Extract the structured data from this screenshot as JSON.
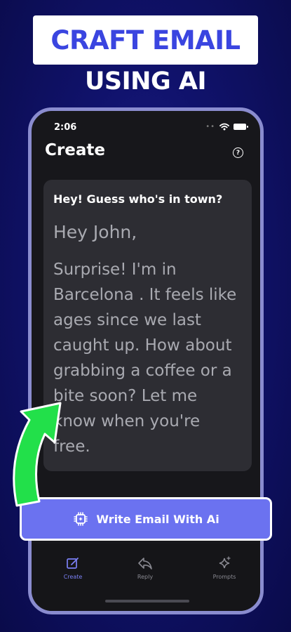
{
  "promo": {
    "headline": "CRAFT EMAIL",
    "subheadline": "USING AI"
  },
  "status_bar": {
    "time": "2:06"
  },
  "screen": {
    "title": "Create",
    "help_symbol": "?"
  },
  "email": {
    "subject": "Hey! Guess who's in town?",
    "greeting": "Hey John,",
    "body": "Surprise! I'm in Barcelona . It feels like ages since we last caught up. How about grabbing a coffee or a bite soon? Let me know when you're free."
  },
  "cta": {
    "label": "Write Email With Ai",
    "icon": "ai-chip-icon"
  },
  "tabbar": {
    "items": [
      {
        "label": "Create",
        "icon": "compose-icon",
        "active": true
      },
      {
        "label": "Reply",
        "icon": "reply-arrow-icon",
        "active": false
      },
      {
        "label": "Prompts",
        "icon": "sparkle-icon",
        "active": false
      }
    ]
  },
  "colors": {
    "background": "#10126b",
    "accent": "#6b72f0",
    "headline_blue": "#3a45e0",
    "arrow_green": "#22e04a",
    "card": "#2d2d33",
    "tab_active": "#7b80f5",
    "tab_inactive": "#8a8a92"
  }
}
